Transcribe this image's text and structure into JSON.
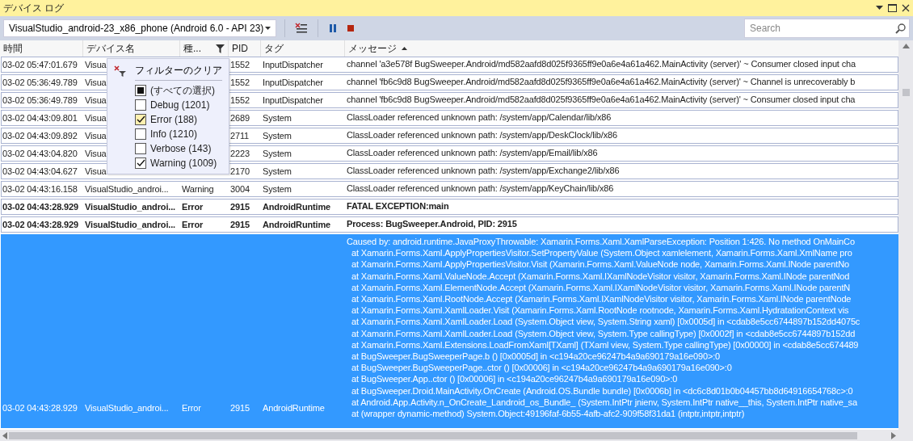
{
  "window": {
    "title": "デバイス ログ"
  },
  "toolbar": {
    "device": "VisualStudio_android-23_x86_phone (Android 6.0 - API 23)",
    "search": {
      "placeholder": "Search"
    }
  },
  "table": {
    "columns": [
      {
        "label": "時間",
        "filter": false,
        "sorted": false
      },
      {
        "label": "デバイス名",
        "filter": false,
        "sorted": false
      },
      {
        "label": "種...",
        "filter": true,
        "sorted": false
      },
      {
        "label": "PID",
        "filter": false,
        "sorted": false
      },
      {
        "label": "タグ",
        "filter": false,
        "sorted": false
      },
      {
        "label": "メッセージ",
        "filter": false,
        "sorted": true
      }
    ],
    "rows": [
      {
        "time": "03-02 05:47:01.679",
        "device": "Visua",
        "pid": "1552",
        "tag": "InputDispatcher",
        "message": "channel 'a3e578f BugSweeper.Android/md582aafd8d025f9365ff9e0a6e4a61a462.MainActivity (server)' ~ Consumer closed input cha",
        "bold": false,
        "selected": false
      },
      {
        "time": "03-02 05:36:49.789",
        "device": "Visua",
        "pid": "1552",
        "tag": "InputDispatcher",
        "message": "channel 'fb6c9d8 BugSweeper.Android/md582aafd8d025f9365ff9e0a6e4a61a462.MainActivity (server)' ~ Channel is unrecoverably b",
        "bold": false,
        "selected": false
      },
      {
        "time": "03-02 05:36:49.789",
        "device": "Visua",
        "pid": "1552",
        "tag": "InputDispatcher",
        "message": "channel 'fb6c9d8 BugSweeper.Android/md582aafd8d025f9365ff9e0a6e4a61a462.MainActivity (server)' ~ Consumer closed input cha",
        "bold": false,
        "selected": false
      },
      {
        "time": "03-02 04:43:09.801",
        "device": "Visua",
        "pid": "2689",
        "tag": "System",
        "message": "ClassLoader referenced unknown path: /system/app/Calendar/lib/x86",
        "bold": false,
        "selected": false
      },
      {
        "time": "03-02 04:43:09.892",
        "device": "Visua",
        "pid": "2711",
        "tag": "System",
        "message": "ClassLoader referenced unknown path: /system/app/DeskClock/lib/x86",
        "bold": false,
        "selected": false
      },
      {
        "time": "03-02 04:43:04.820",
        "device": "Visua",
        "pid": "2223",
        "tag": "System",
        "message": "ClassLoader referenced unknown path: /system/app/Email/lib/x86",
        "bold": false,
        "selected": false
      },
      {
        "time": "03-02 04:43:04.627",
        "device": "Visua",
        "pid": "2170",
        "tag": "System",
        "message": "ClassLoader referenced unknown path: /system/app/Exchange2/lib/x86",
        "bold": false,
        "selected": false
      },
      {
        "time": "03-02 04:43:16.158",
        "device": "VisualStudio_androi...",
        "level": "Warning",
        "pid": "3004",
        "tag": "System",
        "message": "ClassLoader referenced unknown path: /system/app/KeyChain/lib/x86",
        "bold": false,
        "selected": false
      },
      {
        "time": "03-02 04:43:28.929",
        "device": "VisualStudio_androi...",
        "level": "Error",
        "pid": "2915",
        "tag": "AndroidRuntime",
        "message": "FATAL EXCEPTION:main",
        "bold": true,
        "selected": false
      },
      {
        "time": "03-02 04:43:28.929",
        "device": "VisualStudio_androi...",
        "level": "Error",
        "pid": "2915",
        "tag": "AndroidRuntime",
        "message": "Process: BugSweeper.Android, PID: 2915",
        "bold": true,
        "selected": false
      },
      {
        "time": "03-02 04:43:28.929",
        "device": "VisualStudio_androi...",
        "level": "Error",
        "pid": "2915",
        "tag": "AndroidRuntime",
        "message": "Caused by: android.runtime.JavaProxyThrowable: Xamarin.Forms.Xaml.XamlParseException: Position 1:426. No method OnMainCo",
        "bold": false,
        "selected": true,
        "trace": [
          "at Xamarin.Forms.Xaml.ApplyPropertiesVisitor.SetPropertyValue (System.Object xamlelement, Xamarin.Forms.Xaml.XmlName pro",
          "at Xamarin.Forms.Xaml.ApplyPropertiesVisitor.Visit (Xamarin.Forms.Xaml.ValueNode node, Xamarin.Forms.Xaml.INode parentNo",
          "at Xamarin.Forms.Xaml.ValueNode.Accept (Xamarin.Forms.Xaml.IXamlNodeVisitor visitor, Xamarin.Forms.Xaml.INode parentNod",
          "at Xamarin.Forms.Xaml.ElementNode.Accept (Xamarin.Forms.Xaml.IXamlNodeVisitor visitor, Xamarin.Forms.Xaml.INode parentN",
          "at Xamarin.Forms.Xaml.RootNode.Accept (Xamarin.Forms.Xaml.IXamlNodeVisitor visitor, Xamarin.Forms.Xaml.INode parentNode",
          "at Xamarin.Forms.Xaml.XamlLoader.Visit (Xamarin.Forms.Xaml.RootNode rootnode, Xamarin.Forms.Xaml.HydratationContext vis",
          "at Xamarin.Forms.Xaml.XamlLoader.Load (System.Object view, System.String xaml) [0x0005d] in <cdab8e5cc6744897b152dd4075c",
          "at Xamarin.Forms.Xaml.XamlLoader.Load (System.Object view, System.Type callingType) [0x0002f] in <cdab8e5cc6744897b152dd",
          "at Xamarin.Forms.Xaml.Extensions.LoadFromXaml[TXaml] (TXaml view, System.Type callingType) [0x00000] in <cdab8e5cc674489",
          "at BugSweeper.BugSweeperPage.b () [0x0005d] in <c194a20ce96247b4a9a690179a16e090>:0",
          "at BugSweeper.BugSweeperPage..ctor () [0x00006] in <c194a20ce96247b4a9a690179a16e090>:0",
          "at BugSweeper.App..ctor () [0x00006] in <c194a20ce96247b4a9a690179a16e090>:0",
          "at BugSweeper.Droid.MainActivity.OnCreate (Android.OS.Bundle bundle) [0x0006b] in <dc6c8d01b0b04457bb8d64916654768c>:0",
          "at Android.App.Activity.n_OnCreate_Landroid_os_Bundle_ (System.IntPtr jnienv, System.IntPtr native__this, System.IntPtr native_sa",
          "at (wrapper dynamic-method) System.Object:49196faf-6b55-4afb-afc2-909f58f31da1 (intptr,intptr,intptr)"
        ]
      }
    ]
  },
  "filter_menu": {
    "clear_label": "フィルターのクリア",
    "options": [
      {
        "label": "(すべての選択)",
        "checked": false,
        "partial": true,
        "highlighted": false
      },
      {
        "label": "Debug (1201)",
        "checked": false,
        "partial": false,
        "highlighted": false
      },
      {
        "label": "Error (188)",
        "checked": true,
        "partial": false,
        "highlighted": true
      },
      {
        "label": "Info (1210)",
        "checked": false,
        "partial": false,
        "highlighted": false
      },
      {
        "label": "Verbose (143)",
        "checked": false,
        "partial": false,
        "highlighted": false
      },
      {
        "label": "Warning (1009)",
        "checked": true,
        "partial": false,
        "highlighted": false
      }
    ]
  }
}
